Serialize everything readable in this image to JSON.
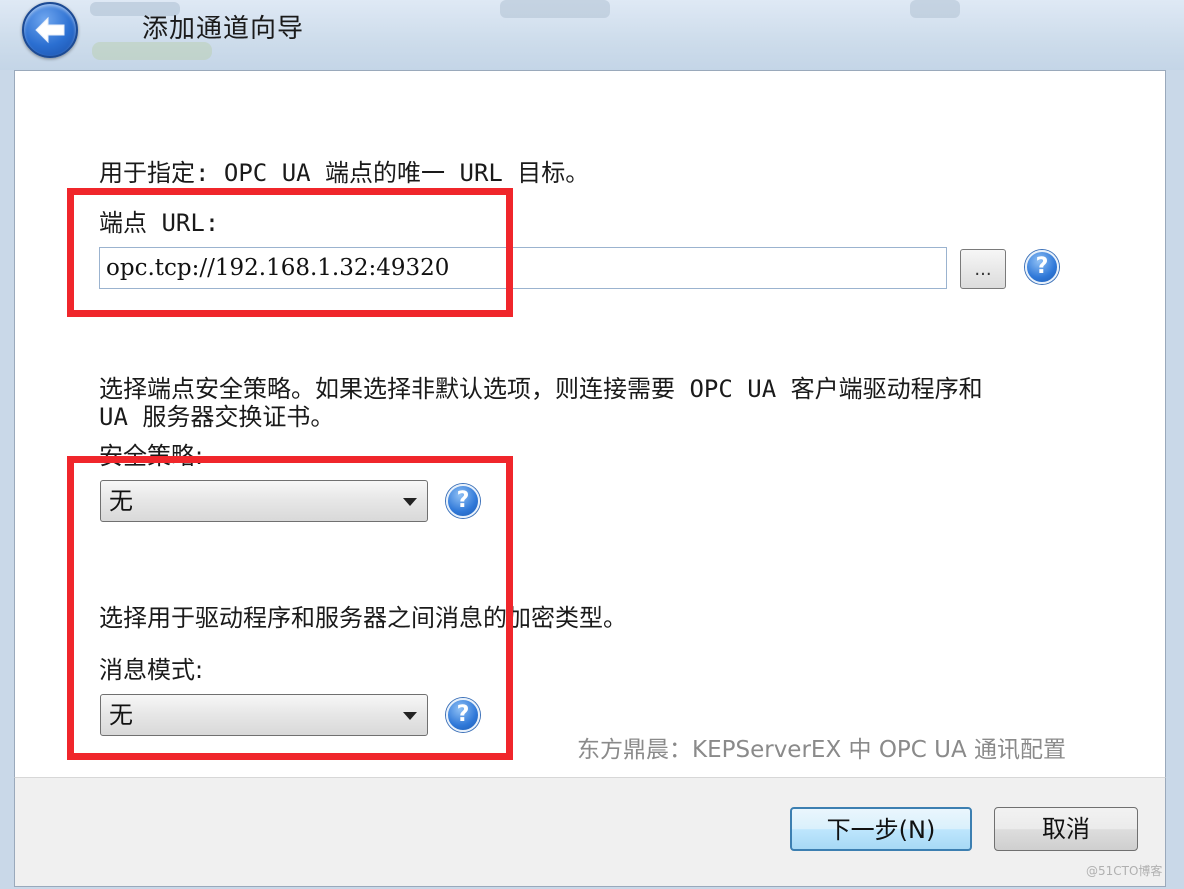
{
  "window": {
    "title": "添加通道向导"
  },
  "endpoint": {
    "description": "用于指定: OPC UA 端点的唯一 URL 目标。",
    "url_label": "端点 URL:",
    "url_value": "opc.tcp://192.168.1.32:49320",
    "browse_label": "...",
    "help_glyph": "?"
  },
  "security": {
    "description_line1": "选择端点安全策略。如果选择非默认选项，则连接需要 OPC UA 客户端驱动程序和",
    "description_line2": "UA 服务器交换证书。",
    "policy_label": "安全策略:",
    "policy_value": "无",
    "encryption_description": "选择用于驱动程序和服务器之间消息的加密类型。",
    "message_mode_label": "消息模式:",
    "message_mode_value": "无"
  },
  "watermark": "东方鼎晨：KEPServerEX 中 OPC UA 通讯配置",
  "buttons": {
    "next": "下一步(N)",
    "cancel": "取消"
  },
  "corner_mark": "@51CTO博客",
  "colors": {
    "highlight_box": "#f0262b",
    "help_icon": "#2f78d8",
    "back_button": "#2b6fd1"
  }
}
